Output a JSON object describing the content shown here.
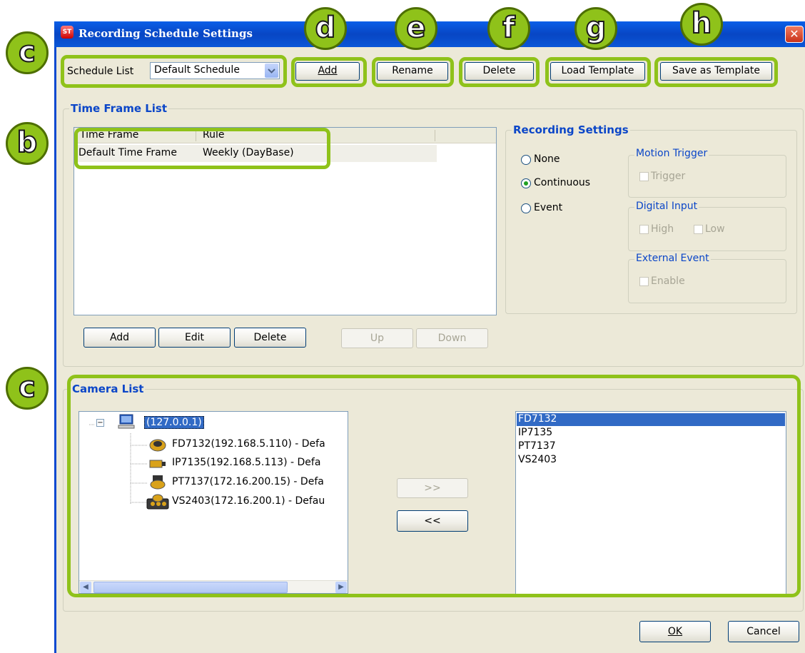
{
  "window": {
    "title": "Recording Schedule Settings",
    "close_glyph": "✕",
    "app_icon_text": "ST"
  },
  "toolbar": {
    "schedule_list_label": "Schedule List",
    "schedule_selected": "Default Schedule",
    "add_label": "Add",
    "rename_label": "Rename",
    "delete_label": "Delete",
    "load_template_label": "Load Template",
    "save_template_label": "Save as Template"
  },
  "time_frame": {
    "group_label": "Time Frame List",
    "columns": [
      "Time Frame",
      "Rule"
    ],
    "rows": [
      {
        "time_frame": "Default Time Frame",
        "rule": "Weekly (DayBase)"
      }
    ],
    "buttons": {
      "add": "Add",
      "edit": "Edit",
      "delete": "Delete",
      "up": "Up",
      "down": "Down"
    }
  },
  "recording": {
    "group_label": "Recording Settings",
    "options": [
      "None",
      "Continuous",
      "Event"
    ],
    "selected": "Continuous",
    "motion_trigger_label": "Motion Trigger",
    "trigger_label": "Trigger",
    "digital_input_label": "Digital Input",
    "high_label": "High",
    "low_label": "Low",
    "external_event_label": "External Event",
    "enable_label": "Enable"
  },
  "camera_list": {
    "group_label": "Camera List",
    "root": "(127.0.0.1)",
    "tree_items": [
      "FD7132(192.168.5.110) - Defa",
      "IP7135(192.168.5.113) - Defa",
      "PT7137(172.16.200.15) - Defa",
      "VS2403(172.16.200.1) - Defau"
    ],
    "add_arrow": ">>",
    "remove_arrow": "<<",
    "selected_cameras": [
      "FD7132",
      "IP7135",
      "PT7137",
      "VS2403"
    ]
  },
  "footer": {
    "ok_label": "OK",
    "cancel_label": "Cancel"
  },
  "badges": {
    "schedule": "c",
    "time_frame": "b",
    "camera": "c",
    "add": "d",
    "rename": "e",
    "delete": "f",
    "load": "g",
    "save": "h"
  },
  "colors": {
    "highlight": "#8fc21a",
    "title_bar": "#0a49d0",
    "dialog_bg": "#ece9d8",
    "group_label": "#0b46c8",
    "selection": "#316ac5"
  }
}
